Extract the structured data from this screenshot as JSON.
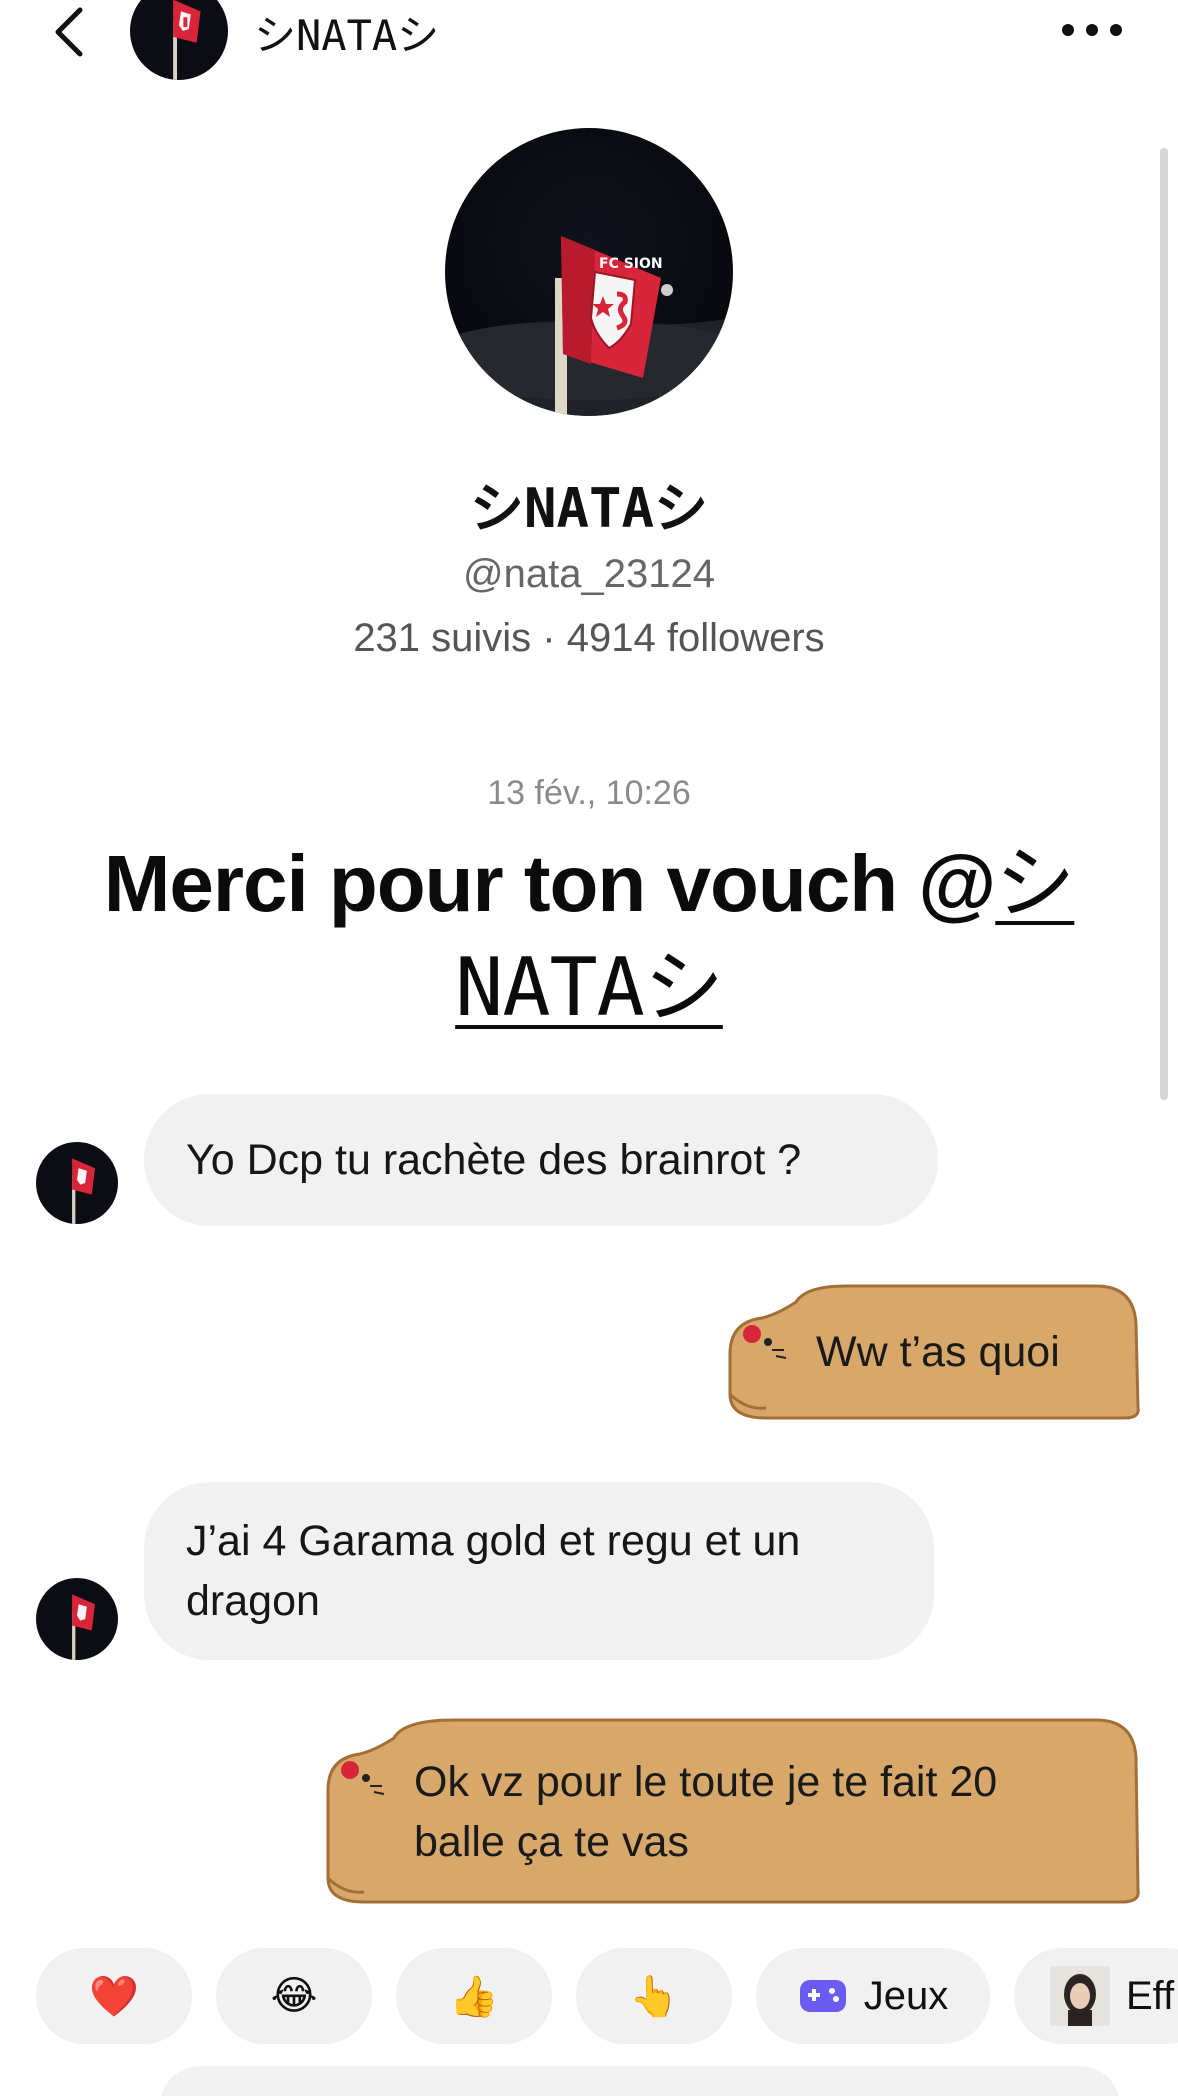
{
  "header": {
    "name": "シNATAシ",
    "back_icon": "chevron-left-icon",
    "more_icon": "ellipsis-icon"
  },
  "profile": {
    "name": "シNATAシ",
    "handle": "@nata_23124",
    "stats": "231 suivis · 4914 followers"
  },
  "conversation": {
    "timestamp": "13 fév., 10:26",
    "headline_prefix": "Merci pour ton vouch @",
    "headline_mention": "シNATAシ",
    "messages": [
      {
        "from": "them",
        "text": "Yo Dcp tu rachète des brainrot ?"
      },
      {
        "from": "me",
        "text": "Ww t’as quoi"
      },
      {
        "from": "them",
        "lines": [
          "J’ai 4 Garama gold et regu et un",
          "dragon"
        ]
      },
      {
        "from": "me",
        "lines": [
          "Ok vz pour le toute je te fait 20",
          "balle ça te vas"
        ]
      }
    ]
  },
  "quick_replies": [
    {
      "emoji": "❤️",
      "icon": "heart-icon"
    },
    {
      "emoji": "😂",
      "icon": "laughing-face-icon"
    },
    {
      "emoji": "👍",
      "icon": "thumbs-up-icon"
    },
    {
      "emoji": "👆",
      "icon": "pointing-up-icon"
    },
    {
      "label": "Jeux",
      "icon": "gamepad-icon"
    },
    {
      "label": "Eff",
      "icon": "portrait-thumbnail"
    }
  ],
  "colors": {
    "bubble_in": "#f1f1f2",
    "bubble_out_capybara": "#d8a86a",
    "accent_game": "#6a5cf0",
    "flag_red": "#d9253a"
  }
}
